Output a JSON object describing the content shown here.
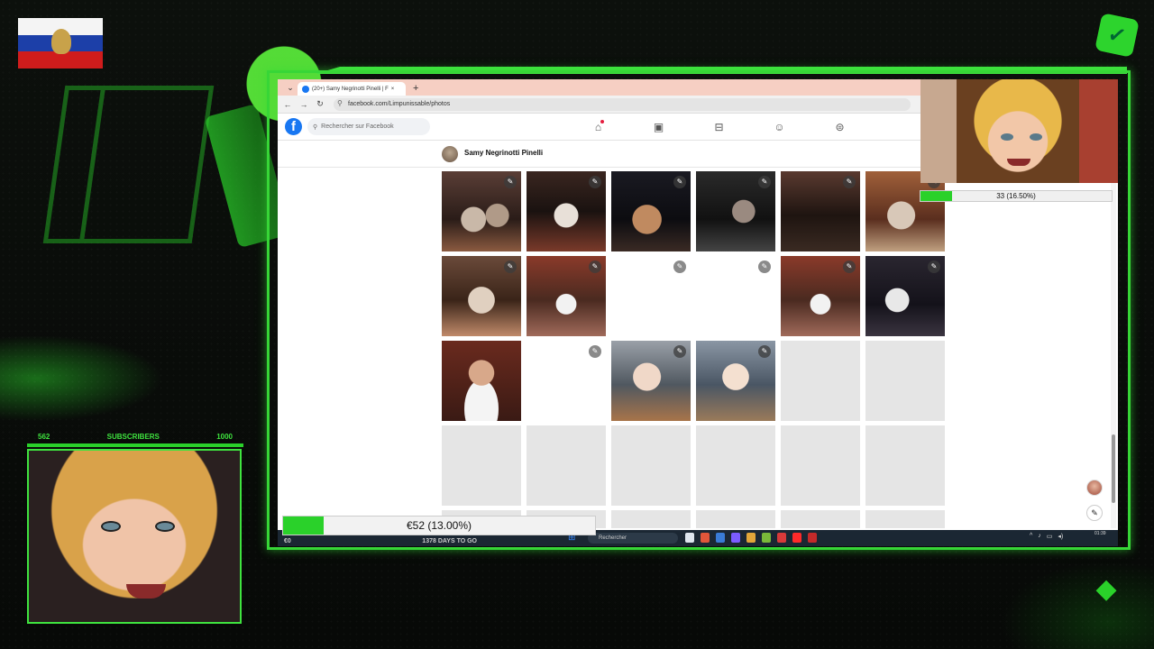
{
  "browser": {
    "tab_title": "(20+) Samy Negrinotti Pinelli | F",
    "tab_add": "+",
    "url": "facebook.com/Limpunissable/photos",
    "nav": [
      "←",
      "→",
      "↻"
    ]
  },
  "facebook": {
    "search_placeholder": "Rechercher sur Facebook",
    "nav_icons": [
      "home-icon",
      "watch-icon",
      "marketplace-icon",
      "groups-icon",
      "gaming-icon"
    ],
    "profile_name": "Samy Negrinotti Pinelli",
    "photo_rows": [
      [
        "photo",
        "photo",
        "photo",
        "photo",
        "photo",
        "photo"
      ],
      [
        "photo",
        "photo",
        "blank",
        "blank",
        "photo",
        "photo"
      ],
      [
        "photo",
        "blank",
        "photo",
        "photo",
        "loading",
        "loading"
      ],
      [
        "loading",
        "loading",
        "loading",
        "loading",
        "loading",
        "loading"
      ]
    ]
  },
  "taskbar": {
    "search_text": "Rechercher",
    "clock_time": "01:39"
  },
  "overlay": {
    "sub_goal_text": "33 (16.50%)",
    "sub_goal_fraction": 0.165,
    "subscribers_current": "562",
    "subscribers_label": "SUBSCRIBERS",
    "subscribers_target": "1000",
    "donation_text": "€52 (13.00%)",
    "donation_fraction": 0.13,
    "donation_left": "€0",
    "donation_days": "1378 DAYS TO GO"
  },
  "colors": {
    "accent_green": "#3fe33f",
    "facebook_blue": "#1877f2"
  }
}
